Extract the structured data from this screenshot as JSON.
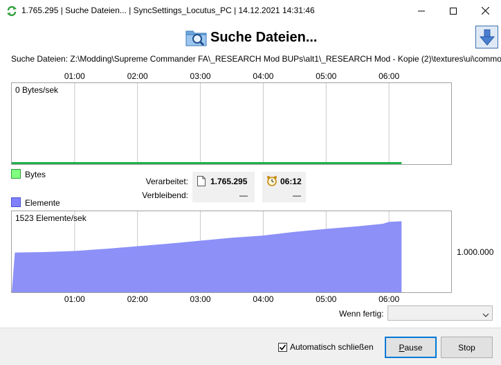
{
  "window": {
    "title": "1.765.295 | Suche Dateien... | SyncSettings_Locutus_PC | 14.12.2021 14:31:46",
    "minimize_glyph": "minimize-icon",
    "maximize_glyph": "maximize-icon",
    "close_glyph": "close-icon"
  },
  "header": {
    "title": "Suche Dateien...",
    "icon": "folder-search-icon",
    "collapse_icon": "arrow-down-icon"
  },
  "status": {
    "path_line": "Suche Dateien: Z:\\Modding\\Supreme Commander FA\\_RESEARCH Mod BUPs\\alt1\\_RESEARCH Mod - Kopie (2)\\textures\\ui\\common\\"
  },
  "timeline_labels": [
    "01:00",
    "02:00",
    "03:00",
    "04:00",
    "05:00",
    "06:00"
  ],
  "chart_data": [
    {
      "type": "area",
      "name": "bytes-graph",
      "title": "0 Bytes/sek",
      "x_unit": "minutes",
      "x": [
        0,
        6.2
      ],
      "values": [
        0,
        0
      ],
      "xlim": [
        0,
        7.0
      ],
      "grid": true,
      "color": "#22b14c"
    },
    {
      "type": "area",
      "name": "elements-graph",
      "title": "1523 Elemente/sek",
      "x_unit": "minutes",
      "x": [
        0,
        0.05,
        0.5,
        1.0,
        1.5,
        2.0,
        2.5,
        3.0,
        3.5,
        4.0,
        4.5,
        5.0,
        5.5,
        5.9,
        6.0,
        6.2
      ],
      "values": [
        0,
        540000,
        545000,
        560000,
        590000,
        625000,
        660000,
        700000,
        740000,
        770000,
        820000,
        860000,
        895000,
        930000,
        955000,
        965000
      ],
      "ylim": [
        0,
        1100000
      ],
      "y_tick_label": "1.000.000",
      "xlim": [
        0,
        7.0
      ],
      "grid": true,
      "color": "#8c90f7"
    }
  ],
  "legend": {
    "bytes": {
      "label": "Bytes",
      "color": "#80ff80"
    },
    "elements": {
      "label": "Elemente",
      "color": "#8080ff"
    }
  },
  "stats": {
    "processed_label": "Verarbeitet:",
    "remaining_label": "Verbleibend:",
    "files_processed": "1.765.295",
    "files_remaining": "—",
    "time_processed": "06:12",
    "time_remaining": "—",
    "file_icon": "file-icon",
    "clock_icon": "alarm-clock-icon"
  },
  "finish": {
    "label": "Wenn fertig:",
    "selected": ""
  },
  "footer": {
    "auto_close_label": "Automatisch schließen",
    "auto_close_checked": true,
    "pause_label": "Pause",
    "stop_label": "Stop"
  }
}
